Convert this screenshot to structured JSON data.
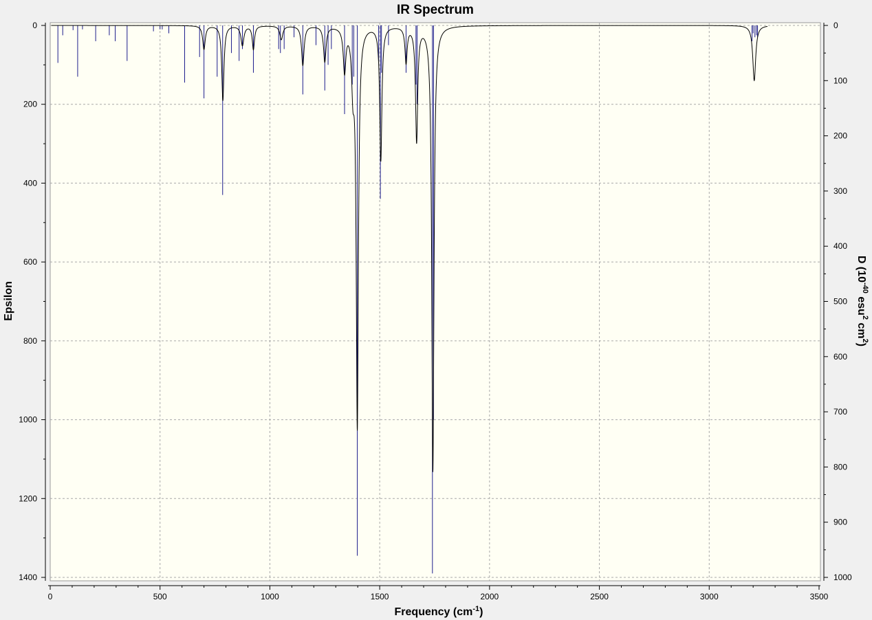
{
  "chart_data": {
    "type": "line",
    "title": "IR Spectrum",
    "xlabel": "Frequency (cm",
    "xlabel_sup": "-1",
    "xlabel_close": ")",
    "ylabel": "Epsilon",
    "y2label": {
      "prefix": "D (10",
      "sup1": "-40",
      "mid": " esu",
      "sup2": "2",
      "mid2": " cm",
      "sup3": "2",
      "close": ")"
    },
    "xlim": [
      0,
      3500
    ],
    "ylim": [
      0,
      1400
    ],
    "y_inverted": true,
    "y2lim": [
      0,
      1000
    ],
    "x_ticks": [
      0,
      500,
      1000,
      1500,
      2000,
      2500,
      3000,
      3500
    ],
    "y_ticks": [
      0,
      200,
      400,
      600,
      800,
      1000,
      1200,
      1400
    ],
    "y2_ticks": [
      0,
      100,
      200,
      300,
      400,
      500,
      600,
      700,
      800,
      900,
      1000
    ],
    "grid": true,
    "background": "#fffff4",
    "colors": {
      "stick": "#1c1c8c",
      "curve": "#000000"
    },
    "series": [
      {
        "name": "",
        "kind": "stick",
        "x": [
          35,
          57,
          104,
          125,
          147,
          207,
          269,
          296,
          350,
          470,
          500,
          510,
          540,
          612,
          680,
          700,
          760,
          785,
          825,
          860,
          875,
          925,
          1040,
          1048,
          1065,
          1110,
          1150,
          1210,
          1250,
          1265,
          1280,
          1340,
          1375,
          1382,
          1398,
          1495,
          1503,
          1508,
          1540,
          1620,
          1665,
          1670,
          1740,
          1745,
          3195,
          3200,
          3208,
          3215,
          3220
        ],
        "values": [
          95,
          25,
          12,
          130,
          10,
          40,
          25,
          40,
          90,
          15,
          10,
          10,
          20,
          145,
          80,
          185,
          130,
          430,
          70,
          90,
          60,
          120,
          60,
          70,
          60,
          30,
          175,
          50,
          165,
          100,
          60,
          225,
          150,
          130,
          1345,
          90,
          440,
          120,
          50,
          120,
          150,
          200,
          1390,
          1000,
          40,
          20,
          30,
          25,
          30
        ]
      },
      {
        "name": "",
        "kind": "curve",
        "peaks": [
          [
            786,
            190,
            6
          ],
          [
            700,
            60,
            7
          ],
          [
            875,
            50,
            8
          ],
          [
            925,
            60,
            6
          ],
          [
            1052,
            35,
            8
          ],
          [
            1150,
            100,
            7
          ],
          [
            1250,
            90,
            7
          ],
          [
            1340,
            110,
            7
          ],
          [
            1378,
            130,
            7
          ],
          [
            1398,
            1010,
            6
          ],
          [
            1505,
            340,
            6
          ],
          [
            1620,
            90,
            6
          ],
          [
            1668,
            290,
            6
          ],
          [
            1742,
            1130,
            6
          ],
          [
            3205,
            140,
            8
          ]
        ]
      }
    ]
  }
}
